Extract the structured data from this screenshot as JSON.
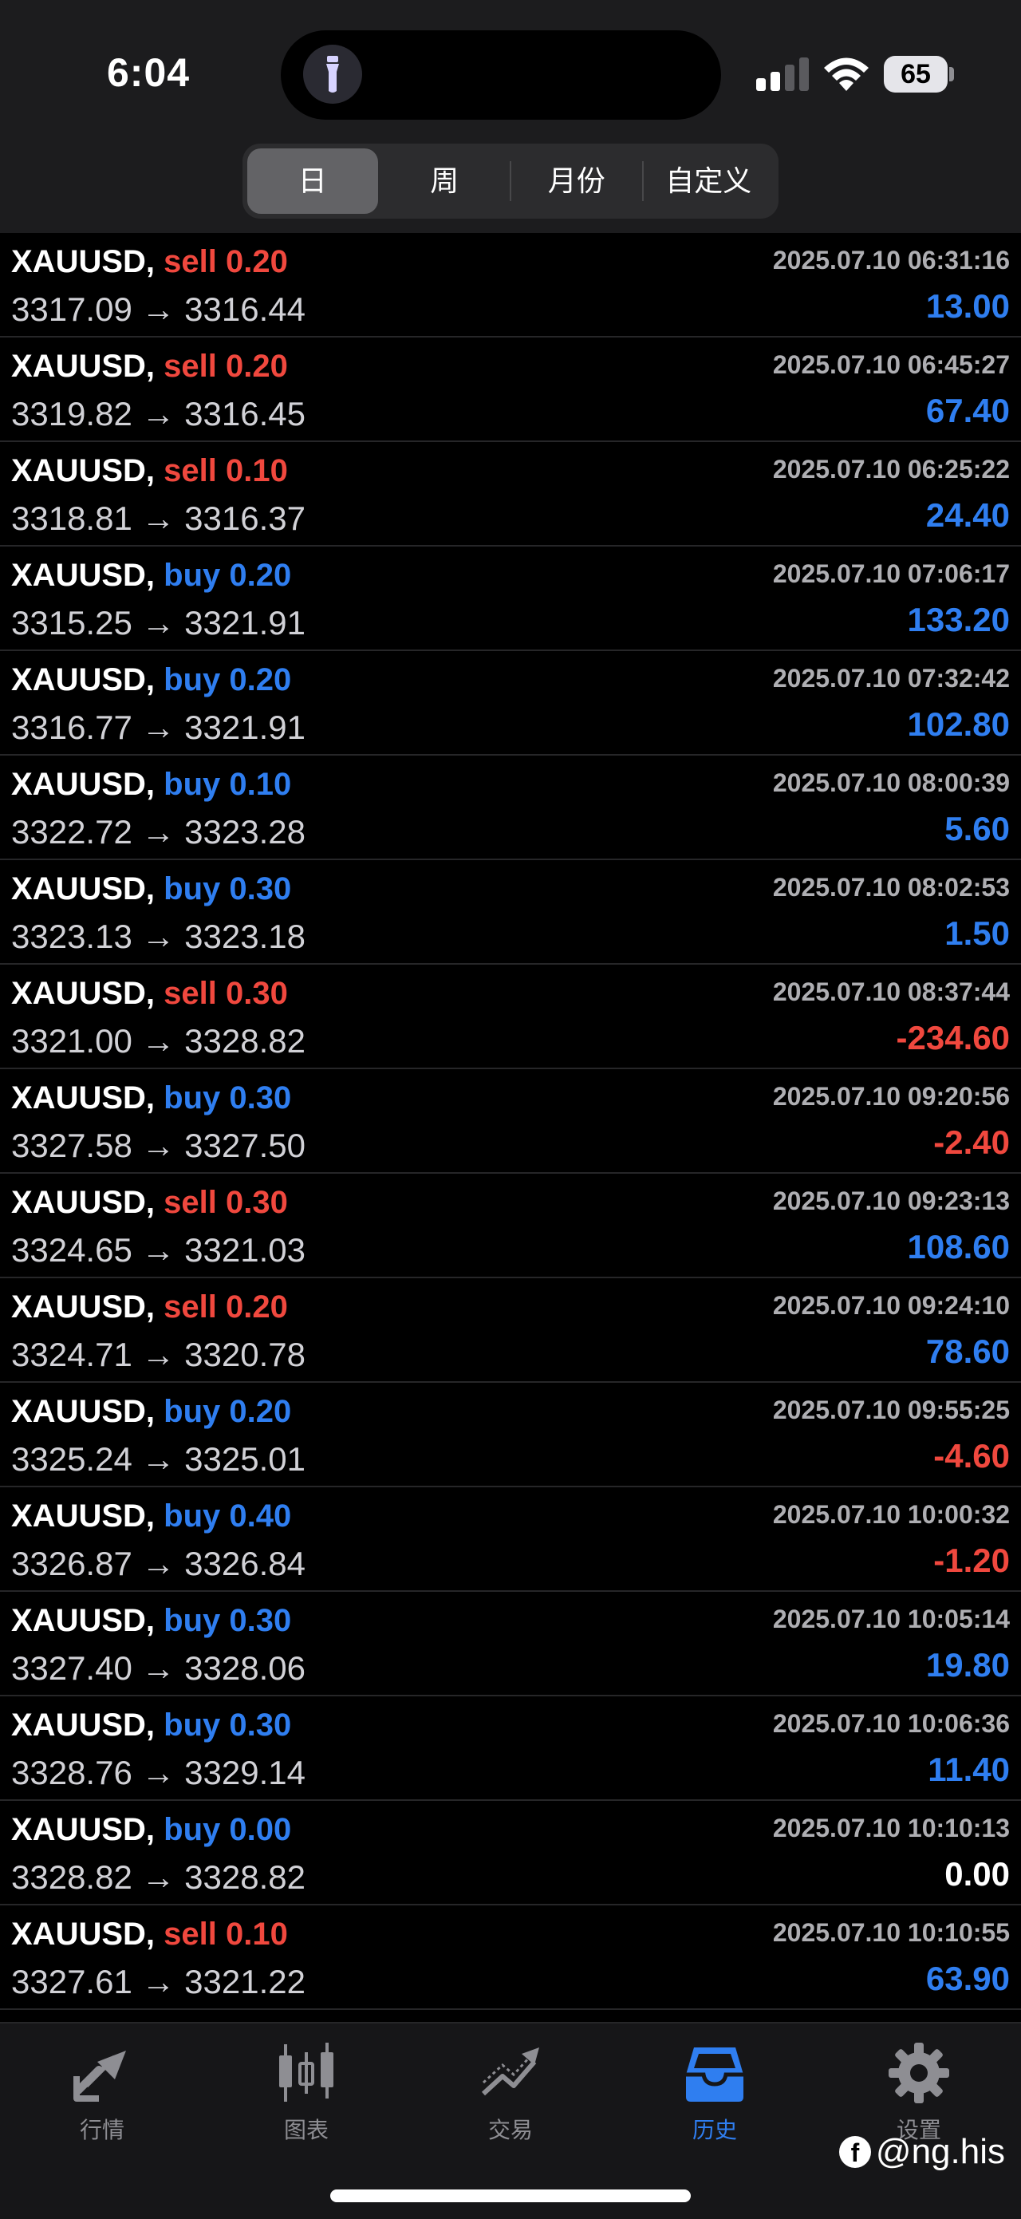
{
  "status_bar": {
    "time": "6:04",
    "battery": "65"
  },
  "period_tabs": [
    "日",
    "周",
    "月份",
    "自定义"
  ],
  "period_selected": "日",
  "deals": [
    {
      "symbol": "XAUUSD,",
      "side": "sell",
      "lot": "0.20",
      "open": "3317.09",
      "arrow": "→",
      "close": "3316.44",
      "time": "2025.07.10 06:31:16",
      "profit": "13.00"
    },
    {
      "symbol": "XAUUSD,",
      "side": "sell",
      "lot": "0.20",
      "open": "3319.82",
      "arrow": "→",
      "close": "3316.45",
      "time": "2025.07.10 06:45:27",
      "profit": "67.40"
    },
    {
      "symbol": "XAUUSD,",
      "side": "sell",
      "lot": "0.10",
      "open": "3318.81",
      "arrow": "→",
      "close": "3316.37",
      "time": "2025.07.10 06:25:22",
      "profit": "24.40"
    },
    {
      "symbol": "XAUUSD,",
      "side": "buy",
      "lot": "0.20",
      "open": "3315.25",
      "arrow": "→",
      "close": "3321.91",
      "time": "2025.07.10 07:06:17",
      "profit": "133.20"
    },
    {
      "symbol": "XAUUSD,",
      "side": "buy",
      "lot": "0.20",
      "open": "3316.77",
      "arrow": "→",
      "close": "3321.91",
      "time": "2025.07.10 07:32:42",
      "profit": "102.80"
    },
    {
      "symbol": "XAUUSD,",
      "side": "buy",
      "lot": "0.10",
      "open": "3322.72",
      "arrow": "→",
      "close": "3323.28",
      "time": "2025.07.10 08:00:39",
      "profit": "5.60"
    },
    {
      "symbol": "XAUUSD,",
      "side": "buy",
      "lot": "0.30",
      "open": "3323.13",
      "arrow": "→",
      "close": "3323.18",
      "time": "2025.07.10 08:02:53",
      "profit": "1.50"
    },
    {
      "symbol": "XAUUSD,",
      "side": "sell",
      "lot": "0.30",
      "open": "3321.00",
      "arrow": "→",
      "close": "3328.82",
      "time": "2025.07.10 08:37:44",
      "profit": "-234.60"
    },
    {
      "symbol": "XAUUSD,",
      "side": "buy",
      "lot": "0.30",
      "open": "3327.58",
      "arrow": "→",
      "close": "3327.50",
      "time": "2025.07.10 09:20:56",
      "profit": "-2.40"
    },
    {
      "symbol": "XAUUSD,",
      "side": "sell",
      "lot": "0.30",
      "open": "3324.65",
      "arrow": "→",
      "close": "3321.03",
      "time": "2025.07.10 09:23:13",
      "profit": "108.60"
    },
    {
      "symbol": "XAUUSD,",
      "side": "sell",
      "lot": "0.20",
      "open": "3324.71",
      "arrow": "→",
      "close": "3320.78",
      "time": "2025.07.10 09:24:10",
      "profit": "78.60"
    },
    {
      "symbol": "XAUUSD,",
      "side": "buy",
      "lot": "0.20",
      "open": "3325.24",
      "arrow": "→",
      "close": "3325.01",
      "time": "2025.07.10 09:55:25",
      "profit": "-4.60"
    },
    {
      "symbol": "XAUUSD,",
      "side": "buy",
      "lot": "0.40",
      "open": "3326.87",
      "arrow": "→",
      "close": "3326.84",
      "time": "2025.07.10 10:00:32",
      "profit": "-1.20"
    },
    {
      "symbol": "XAUUSD,",
      "side": "buy",
      "lot": "0.30",
      "open": "3327.40",
      "arrow": "→",
      "close": "3328.06",
      "time": "2025.07.10 10:05:14",
      "profit": "19.80"
    },
    {
      "symbol": "XAUUSD,",
      "side": "buy",
      "lot": "0.30",
      "open": "3328.76",
      "arrow": "→",
      "close": "3329.14",
      "time": "2025.07.10 10:06:36",
      "profit": "11.40"
    },
    {
      "symbol": "XAUUSD,",
      "side": "buy",
      "lot": "0.00",
      "open": "3328.82",
      "arrow": "→",
      "close": "3328.82",
      "time": "2025.07.10 10:10:13",
      "profit": "0.00"
    },
    {
      "symbol": "XAUUSD,",
      "side": "sell",
      "lot": "0.10",
      "open": "3327.61",
      "arrow": "→",
      "close": "3321.22",
      "time": "2025.07.10 10:10:55",
      "profit": "63.90"
    }
  ],
  "colors": {
    "buy": "#2f7ef0",
    "sell": "#f0483e",
    "profit_positive": "#2f7ef0",
    "profit_negative": "#f0483e",
    "profit_zero": "#ffffff",
    "tab_active": "#2f7ef0",
    "tab_inactive": "#8e8e93"
  },
  "tabbar": [
    {
      "label": "行情",
      "icon": "quotes-arrows-icon"
    },
    {
      "label": "图表",
      "icon": "candlestick-chart-icon"
    },
    {
      "label": "交易",
      "icon": "trade-trend-icon"
    },
    {
      "label": "历史",
      "icon": "history-inbox-icon"
    },
    {
      "label": "设置",
      "icon": "settings-gear-icon"
    }
  ],
  "tab_selected": "历史",
  "watermark": "@ng.his"
}
